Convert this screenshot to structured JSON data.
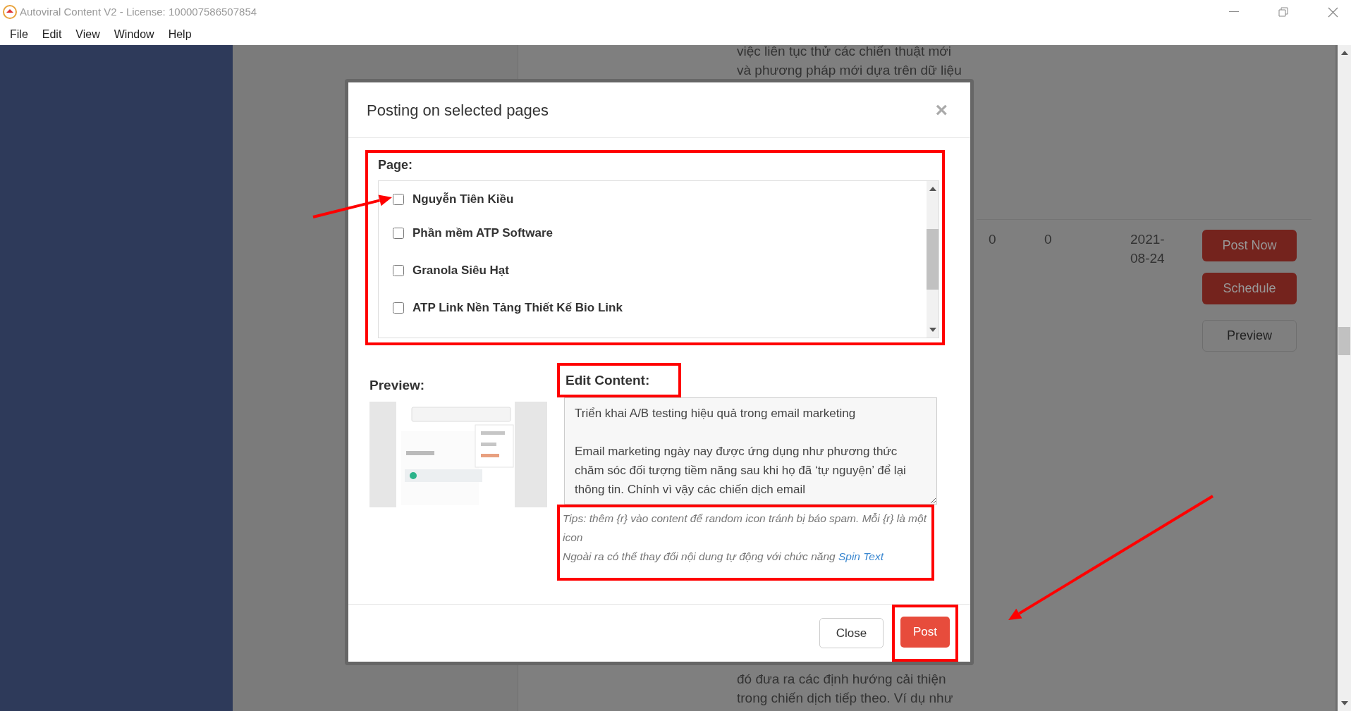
{
  "window": {
    "title": "Autoviral Content V2 - License: 100007586507854"
  },
  "menu": [
    {
      "label": "File"
    },
    {
      "label": "Edit"
    },
    {
      "label": "View"
    },
    {
      "label": "Window"
    },
    {
      "label": "Help"
    }
  ],
  "background": {
    "text_top": [
      "việc liên tục thử các chiến thuật mới",
      "và phương pháp mới dựa trên dữ liệu"
    ],
    "row": {
      "cells": [
        "0",
        "0",
        "2021-08-24"
      ],
      "buttons": [
        {
          "label": "Post Now",
          "kind": "post_now"
        },
        {
          "label": "Schedule",
          "kind": "schedule"
        },
        {
          "label": "Preview",
          "kind": "preview"
        }
      ]
    },
    "text_bottom": [
      "đó đưa ra các định hướng cải thiện",
      "trong chiến dịch tiếp theo. Ví dụ như"
    ]
  },
  "dialog": {
    "title": "Posting on selected pages",
    "close_glyph": "×",
    "page_section": {
      "label": "Page:",
      "highlighted": true,
      "pages": [
        {
          "name": "Nguyễn Tiên Kiều",
          "checked": false
        },
        {
          "name": "Phần mềm ATP Software",
          "checked": false
        },
        {
          "name": "Granola Siêu Hạt",
          "checked": false
        },
        {
          "name": "ATP Link Nền Tảng Thiết Kế Bio Link",
          "checked": false
        }
      ]
    },
    "preview": {
      "label": "Preview:",
      "kind": "picture"
    },
    "edit": {
      "label": "Edit Content:",
      "label_highlighted": true,
      "value": "Triển khai A/B testing hiệu quả trong email marketing\n\nEmail marketing ngày nay được ứng dụng như phương thức chăm sóc đối tượng tiềm năng sau khi họ đã ‘tự nguyện’ để lại thông tin. Chính vì vậy các chiến dịch email"
    },
    "tips": {
      "highlighted": true,
      "line_1": "Tips: thêm {r} vào content để random icon tránh bị báo spam. Mỗi {r} là một icon",
      "line_2": "Ngoài ra có thể thay đổi nội dung tự động với chức năng ",
      "link": "Spin Text"
    },
    "buttons": [
      {
        "label": "Close",
        "kind": "secondary",
        "highlighted": false
      },
      {
        "label": "Post",
        "kind": "primary",
        "highlighted": true
      }
    ]
  },
  "annotations": [
    {
      "kind": "arrow"
    },
    {
      "kind": "arrow"
    }
  ]
}
